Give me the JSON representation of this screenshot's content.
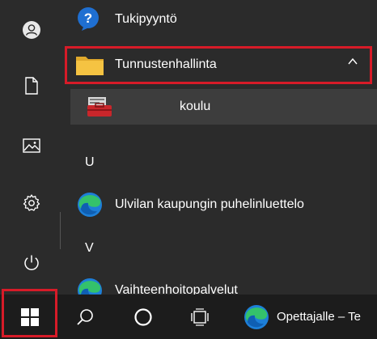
{
  "start_menu": {
    "apps": [
      {
        "label": "Tukipyyntö",
        "icon": "help-app-icon"
      },
      {
        "label": "Tunnustenhallinta",
        "icon": "folder-icon",
        "expanded": true
      },
      {
        "label": "koulu",
        "icon": "toolbox-icon"
      },
      {
        "label": "Ulvilan kaupungin puhelinluettelo",
        "icon": "edge-icon"
      },
      {
        "label": "Vaihteenhoitopalvelut",
        "icon": "edge-icon"
      }
    ],
    "section_letters": [
      "U",
      "V"
    ],
    "rail": [
      "user-icon",
      "document-icon",
      "pictures-icon",
      "settings-icon",
      "power-icon"
    ]
  },
  "taskbar": {
    "items": [
      "start-icon",
      "search-icon",
      "cortana-icon",
      "task-view-icon"
    ],
    "app_label": "Opettajalle – Te"
  },
  "colors": {
    "highlight": "#d71b28",
    "background": "#2b2b2b",
    "taskbar": "#1c1c1c",
    "folder": "#f5c342",
    "help_blue": "#1f6fd1"
  }
}
